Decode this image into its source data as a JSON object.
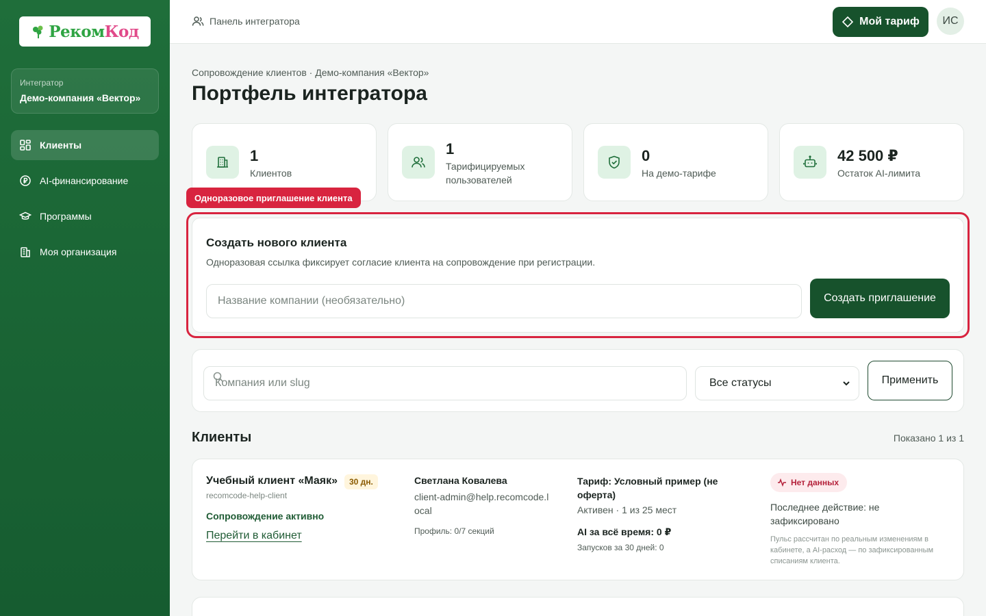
{
  "brand": {
    "logo_part1": "Реком",
    "logo_part2": "Код"
  },
  "org": {
    "label": "Интегратор",
    "name": "Демо-компания «Вектор»"
  },
  "nav": [
    {
      "label": "Клиенты",
      "icon": "grid-icon",
      "active": true
    },
    {
      "label": "AI-финансирование",
      "icon": "ruble-icon",
      "active": false
    },
    {
      "label": "Программы",
      "icon": "graduation-cap-icon",
      "active": false
    },
    {
      "label": "Моя организация",
      "icon": "building-icon",
      "active": false
    }
  ],
  "topbar": {
    "section": "Панель интегратора",
    "tariff_button": "Мой тариф",
    "avatar_initials": "ИС"
  },
  "breadcrumb": "Сопровождение клиентов · Демо-компания «Вектор»",
  "title": "Портфель интегратора",
  "stats": [
    {
      "value": "1",
      "label": "Клиентов",
      "icon": "building-icon"
    },
    {
      "value": "1",
      "label": "Тарифицируемых пользователей",
      "icon": "users-icon"
    },
    {
      "value": "0",
      "label": "На демо-тарифе",
      "icon": "shield-check-icon"
    },
    {
      "value": "42 500 ₽",
      "label": "Остаток AI-лимита",
      "icon": "robot-icon"
    }
  ],
  "invite_badge": "Одноразовое приглашение клиента",
  "create": {
    "title": "Создать нового клиента",
    "description": "Одноразовая ссылка фиксирует согласие клиента на сопровождение при регистрации.",
    "input_placeholder": "Название компании (необязательно)",
    "input_value": "",
    "button": "Создать приглашение"
  },
  "filter": {
    "search_placeholder": "Компания или slug",
    "search_value": "",
    "status_selected": "Все статусы",
    "apply_button": "Применить"
  },
  "clients_section": {
    "title": "Клиенты",
    "shown": "Показано 1 из 1"
  },
  "client": {
    "name": "Учебный клиент «Маяк»",
    "days_badge": "30 дн.",
    "slug": "recomcode-help-client",
    "status": "Сопровождение активно",
    "link": "Перейти в кабинет",
    "contact_name": "Светлана Ковалева",
    "email": "client-admin@help.recomcode.local",
    "profile": "Профиль: 0/7 секций",
    "tariff": "Тариф: Условный пример (не оферта)",
    "tariff_status": "Активен · 1 из 25 мест",
    "ai_total": "AI за всё время: 0 ₽",
    "runs": "Запусков за 30 дней: 0",
    "nodata_badge": "Нет данных",
    "last_action": "Последнее действие: не зафиксировано",
    "pulse_note": "Пульс рассчитан по реальным изменениям в кабинете, а AI-расход — по зафиксированным списаниям клиента."
  },
  "colors": {
    "sidebar": "#1a6535",
    "accent": "#17522c",
    "highlight": "#d8243f"
  }
}
